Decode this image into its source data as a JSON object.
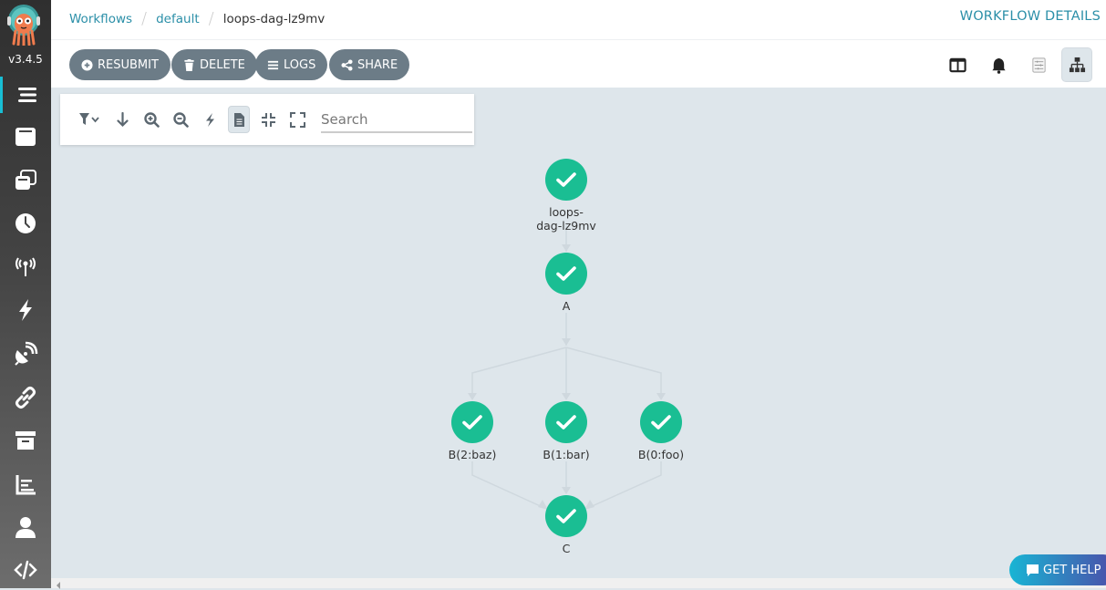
{
  "sidebar": {
    "version": "v3.4.5",
    "items": [
      {
        "icon": "workflows-icon",
        "active": true
      },
      {
        "icon": "workflow-templates-icon"
      },
      {
        "icon": "cluster-workflow-templates-icon"
      },
      {
        "icon": "cron-workflows-icon"
      },
      {
        "icon": "event-sources-icon"
      },
      {
        "icon": "sensors-icon"
      },
      {
        "icon": "event-flow-icon"
      },
      {
        "icon": "api-docs-link-icon"
      },
      {
        "icon": "archived-workflows-icon"
      },
      {
        "icon": "reports-icon"
      },
      {
        "icon": "user-icon"
      },
      {
        "icon": "api-docs-icon"
      }
    ]
  },
  "header": {
    "breadcrumb": [
      "Workflows",
      "default",
      "loops-dag-lz9mv"
    ],
    "title": "WORKFLOW DETAILS"
  },
  "toolbar": {
    "resubmit": "RESUBMIT",
    "delete": "DELETE",
    "logs": "LOGS",
    "share": "SHARE"
  },
  "graph_toolbar": {
    "search_placeholder": "Search"
  },
  "graph": {
    "success_color": "#1abe93",
    "nodes": [
      {
        "id": "root",
        "label_lines": [
          "loops-",
          "dag-lz9mv"
        ],
        "status": "Succeeded"
      },
      {
        "id": "A",
        "label_lines": [
          "A"
        ],
        "status": "Succeeded"
      },
      {
        "id": "B2",
        "label_lines": [
          "B(2:baz)"
        ],
        "status": "Succeeded"
      },
      {
        "id": "B1",
        "label_lines": [
          "B(1:bar)"
        ],
        "status": "Succeeded"
      },
      {
        "id": "B0",
        "label_lines": [
          "B(0:foo)"
        ],
        "status": "Succeeded"
      },
      {
        "id": "C",
        "label_lines": [
          "C"
        ],
        "status": "Succeeded"
      }
    ],
    "edges": [
      [
        "root",
        "A"
      ],
      [
        "A",
        "B2"
      ],
      [
        "A",
        "B1"
      ],
      [
        "A",
        "B0"
      ],
      [
        "B2",
        "C"
      ],
      [
        "B1",
        "C"
      ],
      [
        "B0",
        "C"
      ]
    ]
  },
  "help": {
    "label": "GET HELP"
  }
}
